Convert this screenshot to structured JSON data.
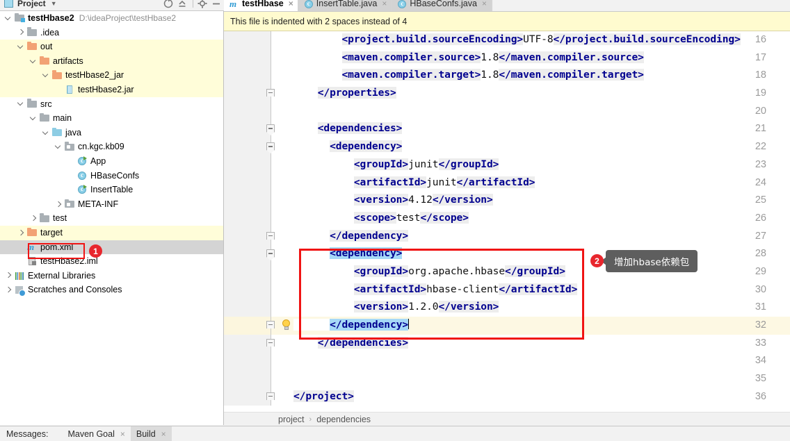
{
  "tool_window": {
    "title": "Project",
    "caret_icon": "chevron-down-icon",
    "buttons": [
      "refresh-icon",
      "collapse-all-icon",
      "settings-gear-icon",
      "hide-icon"
    ]
  },
  "project_tree": [
    {
      "indent": 0,
      "arrow": "down",
      "icon": "module-folder-icon",
      "label": "testHbase2",
      "sub": "D:\\ideaProject\\testHbase2",
      "bold": true,
      "state": "normal"
    },
    {
      "indent": 1,
      "arrow": "right",
      "icon": "folder-gray-icon",
      "label": ".idea",
      "sub": "",
      "bold": false,
      "state": "normal"
    },
    {
      "indent": 1,
      "arrow": "down",
      "icon": "folder-orange-icon",
      "label": "out",
      "sub": "",
      "bold": false,
      "state": "excluded"
    },
    {
      "indent": 2,
      "arrow": "down",
      "icon": "folder-orange-icon",
      "label": "artifacts",
      "sub": "",
      "bold": false,
      "state": "excluded"
    },
    {
      "indent": 3,
      "arrow": "down",
      "icon": "folder-orange-icon",
      "label": "testHbase2_jar",
      "sub": "",
      "bold": false,
      "state": "excluded"
    },
    {
      "indent": 4,
      "arrow": "none",
      "icon": "jar-file-icon",
      "label": "testHbase2.jar",
      "sub": "",
      "bold": false,
      "state": "excluded"
    },
    {
      "indent": 1,
      "arrow": "down",
      "icon": "folder-gray-icon",
      "label": "src",
      "sub": "",
      "bold": false,
      "state": "normal"
    },
    {
      "indent": 2,
      "arrow": "down",
      "icon": "folder-gray-icon",
      "label": "main",
      "sub": "",
      "bold": false,
      "state": "normal"
    },
    {
      "indent": 3,
      "arrow": "down",
      "icon": "folder-source-icon",
      "label": "java",
      "sub": "",
      "bold": false,
      "state": "normal"
    },
    {
      "indent": 4,
      "arrow": "down",
      "icon": "package-icon",
      "label": "cn.kgc.kb09",
      "sub": "",
      "bold": false,
      "state": "normal"
    },
    {
      "indent": 5,
      "arrow": "none",
      "icon": "java-class-run-icon",
      "label": "App",
      "sub": "",
      "bold": false,
      "state": "normal"
    },
    {
      "indent": 5,
      "arrow": "none",
      "icon": "java-class-icon",
      "label": "HBaseConfs",
      "sub": "",
      "bold": false,
      "state": "normal"
    },
    {
      "indent": 5,
      "arrow": "none",
      "icon": "java-class-run-icon",
      "label": "InsertTable",
      "sub": "",
      "bold": false,
      "state": "normal"
    },
    {
      "indent": 4,
      "arrow": "right",
      "icon": "package-icon",
      "label": "META-INF",
      "sub": "",
      "bold": false,
      "state": "normal"
    },
    {
      "indent": 2,
      "arrow": "right",
      "icon": "folder-gray-icon",
      "label": "test",
      "sub": "",
      "bold": false,
      "state": "normal"
    },
    {
      "indent": 1,
      "arrow": "right",
      "icon": "folder-orange-icon",
      "label": "target",
      "sub": "",
      "bold": false,
      "state": "excluded"
    },
    {
      "indent": 1,
      "arrow": "none",
      "icon": "maven-pom-icon",
      "label": "pom.xml",
      "sub": "",
      "bold": false,
      "state": "selected"
    },
    {
      "indent": 1,
      "arrow": "none",
      "icon": "iml-file-icon",
      "label": "testHbase2.iml",
      "sub": "",
      "bold": false,
      "state": "normal"
    },
    {
      "indent": 0,
      "arrow": "right",
      "icon": "external-libraries-icon",
      "label": "External Libraries",
      "sub": "",
      "bold": false,
      "state": "normal"
    },
    {
      "indent": 0,
      "arrow": "right",
      "icon": "scratches-icon",
      "label": "Scratches and Consoles",
      "sub": "",
      "bold": false,
      "state": "normal"
    }
  ],
  "annotations": [
    {
      "number": "1",
      "target": "pom.xml file in project tree"
    },
    {
      "number": "2",
      "target": "hbase dependency block",
      "callout": "增加hbase依赖包"
    }
  ],
  "editor_tabs": [
    {
      "label": "testHbase",
      "icon": "maven-pom-icon",
      "active": true,
      "close": "×"
    },
    {
      "label": "InsertTable.java",
      "icon": "java-class-icon",
      "active": false,
      "close": "×"
    },
    {
      "label": "HBaseConfs.java",
      "icon": "java-class-icon",
      "active": false,
      "close": "×"
    }
  ],
  "banner": {
    "message": "This file is indented with 2 spaces instead of 4"
  },
  "code_lines": [
    {
      "num": "16",
      "fold": "none",
      "bulb": false,
      "current": false,
      "indent": 4,
      "spans": [
        {
          "t": "tg",
          "v": "<project.build.sourceEncoding>"
        },
        {
          "t": "txt",
          "v": "UTF-8"
        },
        {
          "t": "tg",
          "v": "</project.build.sourceEncoding>"
        }
      ]
    },
    {
      "num": "17",
      "fold": "none",
      "bulb": false,
      "current": false,
      "indent": 4,
      "spans": [
        {
          "t": "tg",
          "v": "<maven.compiler.source>"
        },
        {
          "t": "txt",
          "v": "1.8"
        },
        {
          "t": "tg",
          "v": "</maven.compiler.source>"
        }
      ]
    },
    {
      "num": "18",
      "fold": "none",
      "bulb": false,
      "current": false,
      "indent": 4,
      "spans": [
        {
          "t": "tg",
          "v": "<maven.compiler.target>"
        },
        {
          "t": "txt",
          "v": "1.8"
        },
        {
          "t": "tg",
          "v": "</maven.compiler.target>"
        }
      ]
    },
    {
      "num": "19",
      "fold": "end",
      "bulb": false,
      "current": false,
      "indent": 2,
      "spans": [
        {
          "t": "tg",
          "v": "</properties>"
        }
      ]
    },
    {
      "num": "20",
      "fold": "none",
      "bulb": false,
      "current": false,
      "indent": 0,
      "spans": []
    },
    {
      "num": "21",
      "fold": "start",
      "bulb": false,
      "current": false,
      "indent": 2,
      "spans": [
        {
          "t": "tg",
          "v": "<dependencies>"
        }
      ]
    },
    {
      "num": "22",
      "fold": "start",
      "bulb": false,
      "current": false,
      "indent": 3,
      "spans": [
        {
          "t": "tg",
          "v": "<dependency>"
        }
      ]
    },
    {
      "num": "23",
      "fold": "none",
      "bulb": false,
      "current": false,
      "indent": 5,
      "spans": [
        {
          "t": "tg",
          "v": "<groupId>"
        },
        {
          "t": "txt",
          "v": "junit"
        },
        {
          "t": "tg",
          "v": "</groupId>"
        }
      ]
    },
    {
      "num": "24",
      "fold": "none",
      "bulb": false,
      "current": false,
      "indent": 5,
      "spans": [
        {
          "t": "tg",
          "v": "<artifactId>"
        },
        {
          "t": "txt",
          "v": "junit"
        },
        {
          "t": "tg",
          "v": "</artifactId>"
        }
      ]
    },
    {
      "num": "25",
      "fold": "none",
      "bulb": false,
      "current": false,
      "indent": 5,
      "spans": [
        {
          "t": "tg",
          "v": "<version>"
        },
        {
          "t": "txt",
          "v": "4.12"
        },
        {
          "t": "tg",
          "v": "</version>"
        }
      ]
    },
    {
      "num": "26",
      "fold": "none",
      "bulb": false,
      "current": false,
      "indent": 5,
      "spans": [
        {
          "t": "tg",
          "v": "<scope>"
        },
        {
          "t": "txt",
          "v": "test"
        },
        {
          "t": "tg",
          "v": "</scope>"
        }
      ]
    },
    {
      "num": "27",
      "fold": "end",
      "bulb": false,
      "current": false,
      "indent": 3,
      "spans": [
        {
          "t": "tg",
          "v": "</dependency>"
        }
      ]
    },
    {
      "num": "28",
      "fold": "start",
      "bulb": false,
      "current": false,
      "indent": 3,
      "spans": [
        {
          "t": "tgsel",
          "v": "<dependency>"
        }
      ]
    },
    {
      "num": "29",
      "fold": "none",
      "bulb": false,
      "current": false,
      "indent": 5,
      "spans": [
        {
          "t": "tg",
          "v": "<groupId>"
        },
        {
          "t": "txt",
          "v": "org.apache.hbase"
        },
        {
          "t": "tg",
          "v": "</groupId>"
        }
      ]
    },
    {
      "num": "30",
      "fold": "none",
      "bulb": false,
      "current": false,
      "indent": 5,
      "spans": [
        {
          "t": "tg",
          "v": "<artifactId>"
        },
        {
          "t": "txt",
          "v": "hbase-client"
        },
        {
          "t": "tg",
          "v": "</artifactId>"
        }
      ]
    },
    {
      "num": "31",
      "fold": "none",
      "bulb": false,
      "current": false,
      "indent": 5,
      "spans": [
        {
          "t": "tg",
          "v": "<version>"
        },
        {
          "t": "txt",
          "v": "1.2.0"
        },
        {
          "t": "tg",
          "v": "</version>"
        }
      ]
    },
    {
      "num": "32",
      "fold": "end",
      "bulb": true,
      "current": true,
      "indent": 3,
      "spans": [
        {
          "t": "tgsel",
          "v": "</dependency>"
        },
        {
          "t": "caret",
          "v": ""
        }
      ]
    },
    {
      "num": "33",
      "fold": "end",
      "bulb": false,
      "current": false,
      "indent": 2,
      "spans": [
        {
          "t": "tg",
          "v": "</dependencies>"
        }
      ]
    },
    {
      "num": "34",
      "fold": "none",
      "bulb": false,
      "current": false,
      "indent": 0,
      "spans": []
    },
    {
      "num": "35",
      "fold": "none",
      "bulb": false,
      "current": false,
      "indent": 0,
      "spans": []
    },
    {
      "num": "36",
      "fold": "end",
      "bulb": false,
      "current": false,
      "indent": 0,
      "spans": [
        {
          "t": "tg",
          "v": "</project>"
        }
      ]
    }
  ],
  "breadcrumb": {
    "items": [
      "project",
      "dependencies"
    ],
    "separator": "›"
  },
  "status_bar": {
    "label": "Messages:",
    "tabs": [
      {
        "label": "Maven Goal",
        "active": false,
        "close": "×"
      },
      {
        "label": "Build",
        "active": true,
        "close": "×"
      }
    ]
  },
  "colors": {
    "accent_red": "#e8262d",
    "tag_blue": "#00008f",
    "selection_blue": "#a6d9f7",
    "excluded_yellow": "#fffdd9",
    "current_line": "#fdf8e3",
    "banner_yellow": "#fffbcf"
  }
}
